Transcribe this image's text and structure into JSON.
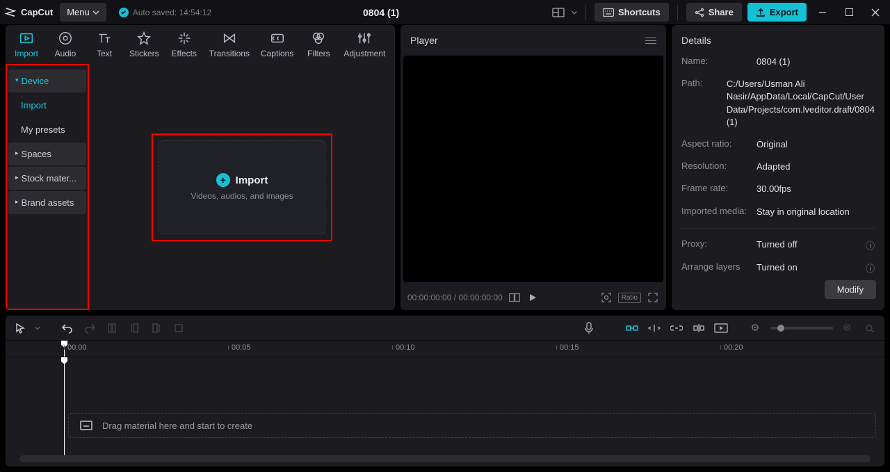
{
  "brand": "CapCut",
  "menuLabel": "Menu",
  "autosave": "Auto saved: 14:54:12",
  "documentTitle": "0804 (1)",
  "titleButtons": {
    "shortcuts": "Shortcuts",
    "share": "Share",
    "export": "Export"
  },
  "topTabs": [
    {
      "label": "Import",
      "icon": "film"
    },
    {
      "label": "Audio",
      "icon": "audio"
    },
    {
      "label": "Text",
      "icon": "text"
    },
    {
      "label": "Stickers",
      "icon": "stickers"
    },
    {
      "label": "Effects",
      "icon": "effects"
    },
    {
      "label": "Transitions",
      "icon": "transitions"
    },
    {
      "label": "Captions",
      "icon": "captions"
    },
    {
      "label": "Filters",
      "icon": "filters"
    },
    {
      "label": "Adjustment",
      "icon": "adjust"
    }
  ],
  "sidebar": {
    "items": [
      {
        "label": "Device",
        "type": "head",
        "caret": "down",
        "active": true
      },
      {
        "label": "Import",
        "type": "sub",
        "active": true
      },
      {
        "label": "My presets",
        "type": "sub",
        "active": false
      },
      {
        "label": "Spaces",
        "type": "head",
        "caret": "right"
      },
      {
        "label": "Stock mater...",
        "type": "head",
        "caret": "right"
      },
      {
        "label": "Brand assets",
        "type": "head",
        "caret": "right"
      }
    ]
  },
  "importBox": {
    "title": "Import",
    "subtitle": "Videos, audios, and images"
  },
  "player": {
    "title": "Player",
    "timecode": "00:00:00:00 / 00:00:00:00",
    "ratio": "Ratio"
  },
  "details": {
    "title": "Details",
    "rows": {
      "name": {
        "label": "Name:",
        "value": "0804 (1)"
      },
      "path": {
        "label": "Path:",
        "value": "C:/Users/Usman Ali Nasir/AppData/Local/CapCut/User Data/Projects/com.lveditor.draft/0804 (1)"
      },
      "aspect": {
        "label": "Aspect ratio:",
        "value": "Original"
      },
      "resolution": {
        "label": "Resolution:",
        "value": "Adapted"
      },
      "fps": {
        "label": "Frame rate:",
        "value": "30.00fps"
      },
      "imported": {
        "label": "Imported media:",
        "value": "Stay in original location"
      },
      "proxy": {
        "label": "Proxy:",
        "value": "Turned off"
      },
      "arrange": {
        "label": "Arrange layers",
        "value": "Turned on"
      }
    },
    "modify": "Modify"
  },
  "timeline": {
    "marks": [
      "00:00",
      "00:05",
      "00:10",
      "00:15",
      "00:20"
    ],
    "hint": "Drag material here and start to create"
  }
}
